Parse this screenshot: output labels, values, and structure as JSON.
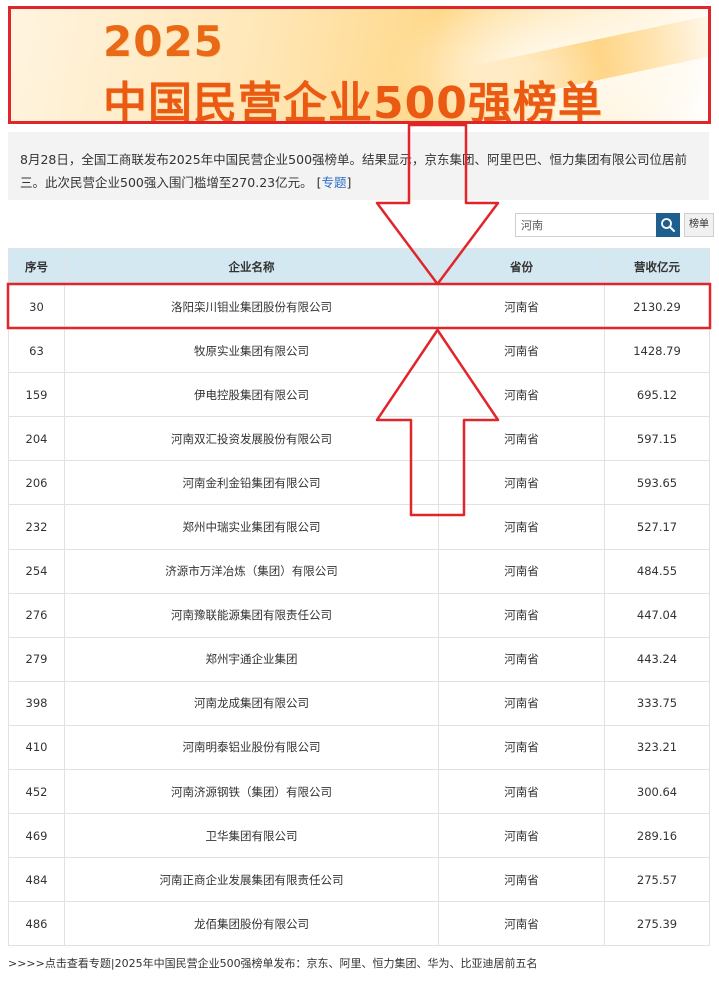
{
  "banner": {
    "year": "2025",
    "headline": "中国民营企业500强榜单"
  },
  "intro": {
    "text": "8月28日，全国工商联发布2025年中国民营企业500强榜单。结果显示，京东集团、阿里巴巴、恒力集团有限公司位居前三。此次民营企业500强入围门槛增至270.23亿元。",
    "link_open": "[",
    "link_label": "专题",
    "link_close": "]"
  },
  "search": {
    "value": "河南",
    "icon": "search-icon",
    "list_label": "榜单"
  },
  "table": {
    "headers": [
      "序号",
      "企业名称",
      "省份",
      "营收亿元"
    ],
    "rows": [
      [
        "30",
        "洛阳栾川钼业集团股份有限公司",
        "河南省",
        "2130.29"
      ],
      [
        "63",
        "牧原实业集团有限公司",
        "河南省",
        "1428.79"
      ],
      [
        "159",
        "伊电控股集团有限公司",
        "河南省",
        "695.12"
      ],
      [
        "204",
        "河南双汇投资发展股份有限公司",
        "河南省",
        "597.15"
      ],
      [
        "206",
        "河南金利金铅集团有限公司",
        "河南省",
        "593.65"
      ],
      [
        "232",
        "郑州中瑞实业集团有限公司",
        "河南省",
        "527.17"
      ],
      [
        "254",
        "济源市万洋冶炼（集团）有限公司",
        "河南省",
        "484.55"
      ],
      [
        "276",
        "河南豫联能源集团有限责任公司",
        "河南省",
        "447.04"
      ],
      [
        "279",
        "郑州宇通企业集团",
        "河南省",
        "443.24"
      ],
      [
        "398",
        "河南龙成集团有限公司",
        "河南省",
        "333.75"
      ],
      [
        "410",
        "河南明泰铝业股份有限公司",
        "河南省",
        "323.21"
      ],
      [
        "452",
        "河南济源钢铁（集团）有限公司",
        "河南省",
        "300.64"
      ],
      [
        "469",
        "卫华集团有限公司",
        "河南省",
        "289.16"
      ],
      [
        "484",
        "河南正商企业发展集团有限责任公司",
        "河南省",
        "275.57"
      ],
      [
        "486",
        "龙佰集团股份有限公司",
        "河南省",
        "275.39"
      ]
    ]
  },
  "footer": {
    "text": ">>>>点击查看专题|2025年中国民营企业500强榜单发布：京东、阿里、恒力集团、华为、比亚迪居前五名"
  },
  "colors": {
    "annotation_red": "#e0252b",
    "header_bg": "#d4e8f1",
    "search_button": "#1e5f8e",
    "link": "#2a6fc9",
    "banner_text": "#ea5a12"
  }
}
